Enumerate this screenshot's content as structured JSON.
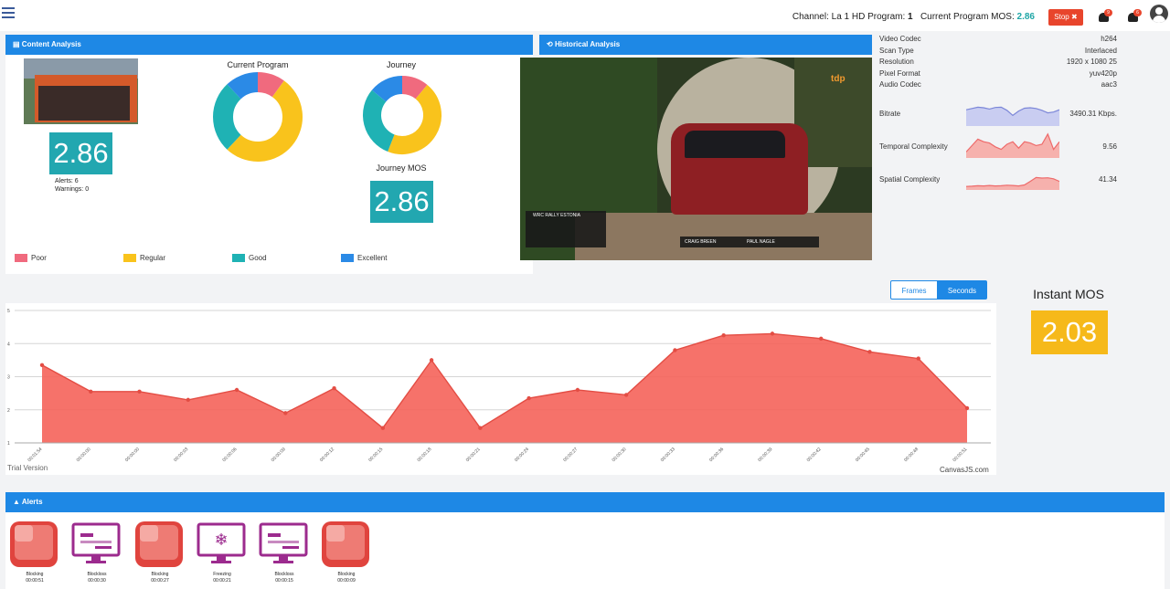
{
  "topbar": {
    "channel_label": "Channel:",
    "channel_value": "La 1 HD",
    "program_label": "Program:",
    "program_value": "1",
    "mos_label": "Current Program MOS:",
    "mos_value": "2.86",
    "stop_label": "Stop",
    "bell_badge_1": "9",
    "bell_badge_2": "6",
    "colors": {
      "accent": "#1e88e5",
      "stop": "#e8452c",
      "mos": "#1fa6a6"
    }
  },
  "content_analysis": {
    "title": "Content Analysis",
    "mos_value": "2.86",
    "alerts_text": "Alerts: 6",
    "warnings_text": "Warnings: 0",
    "current_program_title": "Current Program",
    "journey_title": "Journey",
    "journey_mos_title": "Journey MOS",
    "journey_mos_value": "2.86",
    "legend": [
      {
        "label": "Poor",
        "color": "#f06a7e"
      },
      {
        "label": "Regular",
        "color": "#f9c31c"
      },
      {
        "label": "Good",
        "color": "#1fb2b4"
      },
      {
        "label": "Excellent",
        "color": "#2b8ae6"
      }
    ],
    "current_program_donut": [
      {
        "label": "Poor",
        "value": 10
      },
      {
        "label": "Regular",
        "value": 52
      },
      {
        "label": "Good",
        "value": 26
      },
      {
        "label": "Excellent",
        "value": 12
      }
    ],
    "journey_donut": [
      {
        "label": "Poor",
        "value": 11
      },
      {
        "label": "Regular",
        "value": 45
      },
      {
        "label": "Good",
        "value": 30
      },
      {
        "label": "Excellent",
        "value": 14
      }
    ]
  },
  "historical_analysis": {
    "title": "Historical Analysis",
    "video_logo": "tdp",
    "overlay_title": "WRC RALLY ESTONIA",
    "overlay_driver": "CRAIG BREEN",
    "overlay_codriver": "PAUL NAGLE"
  },
  "stats": [
    {
      "label": "Video Codec",
      "value": "h264"
    },
    {
      "label": "Scan Type",
      "value": "Interlaced"
    },
    {
      "label": "Resolution",
      "value": "1920 x 1080 25"
    },
    {
      "label": "Pixel Format",
      "value": "yuv420p"
    },
    {
      "label": "Audio Codec",
      "value": "aac3"
    }
  ],
  "metrics": [
    {
      "label": "Bitrate",
      "value": "3490.31 Kbps.",
      "color": "#7b86d8",
      "fill": "#c9cdf1",
      "series": [
        6,
        6.5,
        7,
        6.8,
        6.3,
        6.9,
        7,
        5.8,
        3.8,
        5.5,
        6.6,
        6.8,
        6.5,
        5.8,
        4.8,
        5.1,
        6
      ]
    },
    {
      "label": "Temporal Complexity",
      "value": "9.56",
      "color": "#ee6a6a",
      "fill": "#f6b1ad",
      "series": [
        2,
        4.5,
        7,
        6,
        5.5,
        4,
        3,
        5,
        6,
        3.5,
        6,
        5.5,
        4.5,
        5,
        9,
        3,
        6
      ]
    },
    {
      "label": "Spatial Complexity",
      "value": "41.34",
      "color": "#ee6a6a",
      "fill": "#f6b1ad",
      "series": [
        1,
        1.1,
        1.3,
        1.2,
        1.4,
        1.2,
        1.3,
        1.5,
        1.4,
        1.2,
        1.6,
        3,
        4.5,
        4.3,
        4.4,
        4,
        3
      ]
    }
  ],
  "main_chart": {
    "toggle_frames": "Frames",
    "toggle_seconds": "Seconds",
    "trial_text": "Trial Version",
    "credit_text": "CanvasJS.com",
    "chart_data": {
      "type": "area",
      "ylim": [
        1,
        5
      ],
      "y_ticks": [
        "1",
        "2",
        "3",
        "4",
        "5"
      ],
      "categories": [
        "00:01:54",
        "00:00:00",
        "00:00:00",
        "00:00:03",
        "00:00:06",
        "00:00:09",
        "00:00:12",
        "00:00:15",
        "00:00:18",
        "00:00:21",
        "00:00:24",
        "00:00:27",
        "00:00:30",
        "00:00:33",
        "00:00:36",
        "00:00:39",
        "00:00:42",
        "00:00:45",
        "00:00:48",
        "00:00:51"
      ],
      "series": [
        {
          "values": [
            3.35,
            2.55,
            2.55,
            2.3,
            2.6,
            1.9,
            2.65,
            1.45,
            3.5,
            1.45,
            2.35,
            2.6,
            2.45,
            3.8,
            4.25,
            4.3,
            4.15,
            3.75,
            3.55,
            2.05
          ],
          "color": "#f5635a"
        }
      ]
    }
  },
  "instant_mos": {
    "title": "Instant MOS",
    "value": "2.03"
  },
  "alerts": {
    "title": "Alerts",
    "items": [
      {
        "type": "Blocking",
        "time": "00:00:51"
      },
      {
        "type": "Blockloss",
        "time": "00:00:30"
      },
      {
        "type": "Blocking",
        "time": "00:00:27"
      },
      {
        "type": "Freezing",
        "time": "00:00:21"
      },
      {
        "type": "Blockloss",
        "time": "00:00:15"
      },
      {
        "type": "Blocking",
        "time": "00:00:09"
      }
    ]
  }
}
